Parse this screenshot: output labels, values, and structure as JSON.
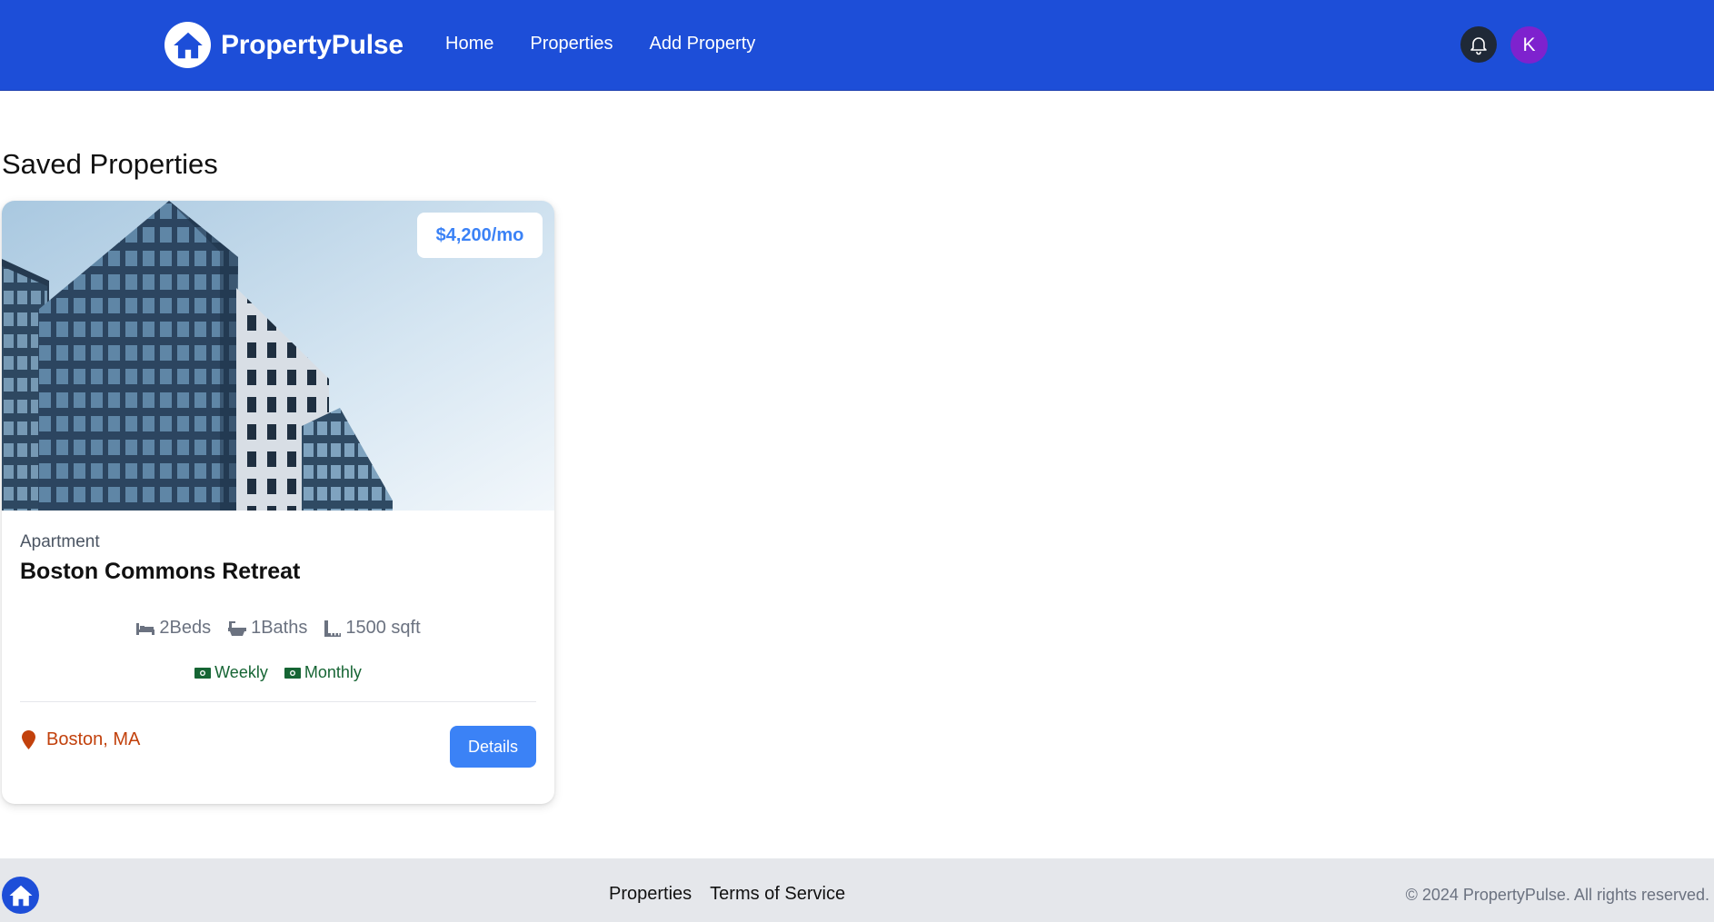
{
  "header": {
    "brand": "PropertyPulse",
    "nav": [
      "Home",
      "Properties",
      "Add Property"
    ],
    "avatar_initial": "K",
    "icons": {
      "logo": "house-icon",
      "notifications": "bell-icon"
    }
  },
  "main": {
    "title": "Saved Properties",
    "card": {
      "price": "$4,200/mo",
      "type": "Apartment",
      "name": "Boston Commons Retreat",
      "beds": "2Beds",
      "baths": "1Baths",
      "sqft": "1500 sqft",
      "rates": [
        "Weekly",
        "Monthly"
      ],
      "location": "Boston, MA",
      "details_label": "Details"
    }
  },
  "footer": {
    "links": [
      "Properties",
      "Terms of Service"
    ],
    "copyright": "© 2024 PropertyPulse. All rights reserved."
  },
  "colors": {
    "header_bg": "#1d4ed8",
    "accent": "#3b82f6",
    "avatar_bg": "#7e22ce",
    "location": "#c2410c",
    "rate_text": "#166534",
    "footer_bg": "#e5e7eb"
  }
}
